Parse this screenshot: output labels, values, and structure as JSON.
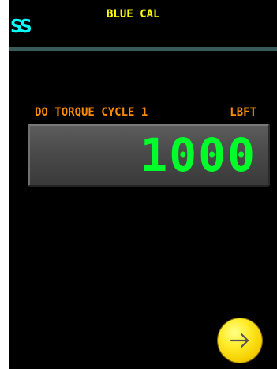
{
  "header": {
    "logo_text": "SS",
    "title": "BLUE CAL"
  },
  "field": {
    "label": "DO TORQUE CYCLE 1",
    "unit": "LBFT",
    "value": "1000"
  },
  "icons": {
    "next": "arrow-right-icon"
  },
  "colors": {
    "background": "#000000",
    "title_text": "#ffff00",
    "label_text": "#ff8c00",
    "logo_text": "#00ffff",
    "value_text": "#00ff2a",
    "divider": "#3a5a5c",
    "next_button": "#ffe600"
  }
}
